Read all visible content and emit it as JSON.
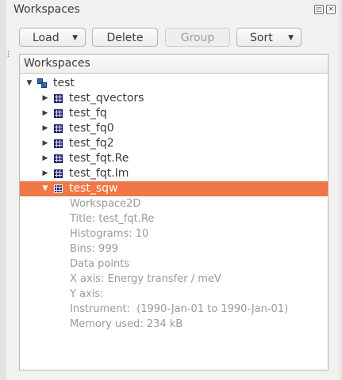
{
  "dock": {
    "title": "Workspaces",
    "float_glyph": "◰",
    "close_glyph": "✕"
  },
  "toolbar": {
    "load_label": "Load",
    "delete_label": "Delete",
    "group_label": "Group",
    "sort_label": "Sort",
    "dropdown_glyph": "▼"
  },
  "panel": {
    "header": "Workspaces",
    "root": {
      "name": "test",
      "expanded_glyph": "▼"
    },
    "items": [
      {
        "name": "test_qvectors",
        "glyph": "▶"
      },
      {
        "name": "test_fq",
        "glyph": "▶"
      },
      {
        "name": "test_fq0",
        "glyph": "▶"
      },
      {
        "name": "test_fq2",
        "glyph": "▶"
      },
      {
        "name": "test_fqt.Re",
        "glyph": "▶"
      },
      {
        "name": "test_fqt.Im",
        "glyph": "▶"
      },
      {
        "name": "test_sqw",
        "glyph": "▼",
        "selected": true
      }
    ],
    "details": [
      "Workspace2D",
      "Title: test_fqt.Re",
      "Histograms: 10",
      "Bins: 999",
      "Data points",
      "X axis: Energy transfer / meV",
      "Y axis:",
      "Instrument:  (1990-Jan-01 to 1990-Jan-01)",
      "Memory used: 234 kB"
    ]
  },
  "colors": {
    "selection": "#f07746",
    "workspace_icon": "#2b2f7a",
    "detail_text": "#9a9a9a"
  }
}
